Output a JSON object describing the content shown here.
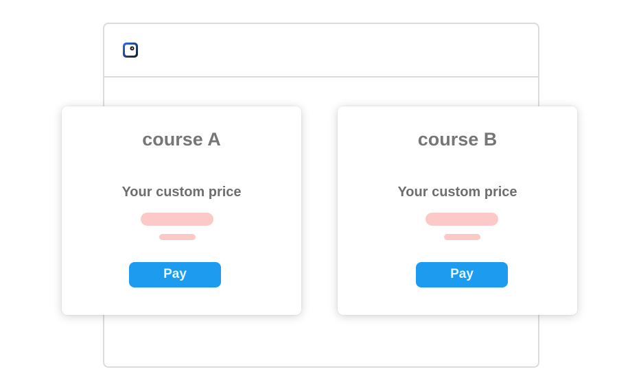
{
  "app": {
    "icon": "app-logo-icon"
  },
  "courses": [
    {
      "title": "course A",
      "price_label": "Your custom price",
      "pay_label": "Pay"
    },
    {
      "title": "course B",
      "price_label": "Your custom price",
      "pay_label": "Pay"
    }
  ],
  "colors": {
    "accent": "#1c9bef",
    "skeleton": "#fcc9c9",
    "title_text": "#767676",
    "border": "#dcdcdc"
  }
}
